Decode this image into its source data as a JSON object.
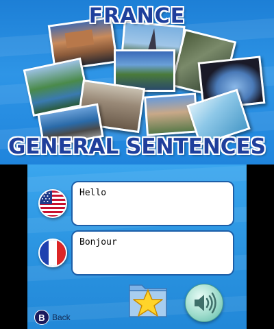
{
  "top_screen": {
    "title_line1": "FRANCE",
    "title_line2": "GENERAL SENTENCES",
    "accent_color": "#1f3f9c",
    "background_color": "#2e95e6",
    "photos": [
      "castle-hill-photo",
      "eiffel-tower-photo",
      "cliff-gorge-photo",
      "river-landscape-photo",
      "arch-bridge-photo",
      "lake-valley-photo",
      "city-rooftops-photo",
      "stone-tower-village-photo",
      "glass-sculpture-photo",
      "rocky-coast-photo"
    ]
  },
  "bottom_screen": {
    "english_flag": "us-flag-icon",
    "french_flag": "france-flag-icon",
    "english_text": "Hello",
    "french_text": "Bonjour",
    "favorite_icon": "star-folder-icon",
    "sound_icon": "speaker-icon",
    "back_key": "B",
    "back_label": "Back"
  }
}
